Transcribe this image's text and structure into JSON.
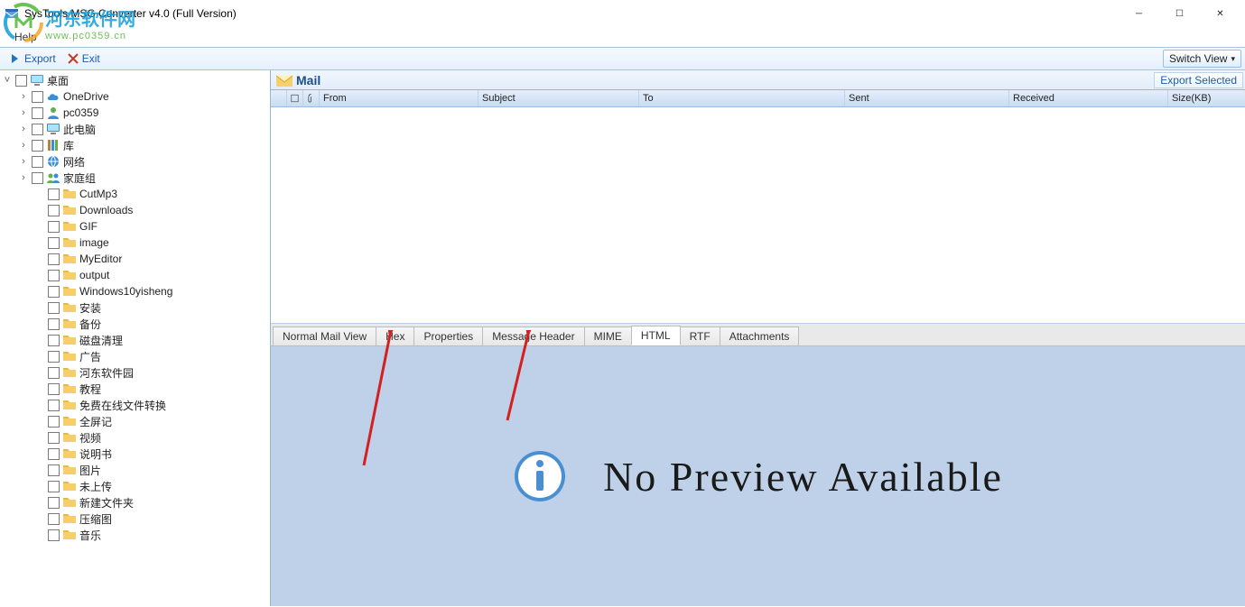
{
  "window": {
    "title": "SysTools MSG Converter v4.0 (Full Version)"
  },
  "menu": {
    "help": "Help"
  },
  "toolbar": {
    "export": "Export",
    "exit": "Exit",
    "switch_view": "Switch View"
  },
  "tree": {
    "root": {
      "label": "桌面"
    },
    "special": [
      {
        "label": "OneDrive",
        "icon": "cloud"
      },
      {
        "label": "pc0359",
        "icon": "user"
      },
      {
        "label": "此电脑",
        "icon": "pc"
      },
      {
        "label": "库",
        "icon": "lib"
      },
      {
        "label": "网络",
        "icon": "net"
      },
      {
        "label": "家庭组",
        "icon": "group"
      }
    ],
    "folders": [
      "CutMp3",
      "Downloads",
      "GIF",
      "image",
      "MyEditor",
      "output",
      "Windows10yisheng",
      "安装",
      "备份",
      "磁盘清理",
      "广告",
      "河东软件园",
      "教程",
      "免费在线文件转换",
      "全屏记",
      "视频",
      "说明书",
      "图片",
      "未上传",
      "新建文件夹",
      "压缩图",
      "音乐"
    ]
  },
  "mail": {
    "title": "Mail",
    "export_selected": "Export Selected",
    "columns": {
      "from": "From",
      "subject": "Subject",
      "to": "To",
      "sent": "Sent",
      "received": "Received",
      "size": "Size(KB)"
    }
  },
  "tabs": {
    "normal": "Normal Mail View",
    "hex": "Hex",
    "properties": "Properties",
    "header": "Message Header",
    "mime": "MIME",
    "html": "HTML",
    "rtf": "RTF",
    "attachments": "Attachments"
  },
  "preview": {
    "message": "No Preview Available"
  },
  "watermark": {
    "line1": "河东软件网",
    "line2": "www.pc0359.cn"
  }
}
